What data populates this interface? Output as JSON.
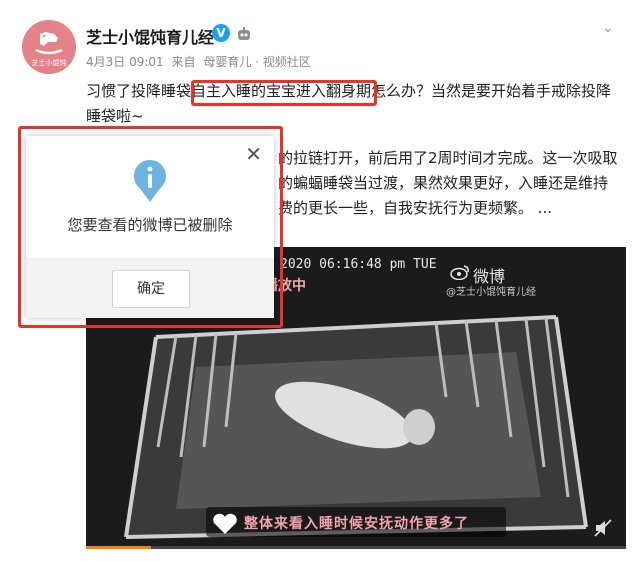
{
  "post": {
    "username": "芝士小馄饨育儿经",
    "verified_badge": "V",
    "avatar_caption": "芝士小馄饨",
    "meta": {
      "date": "4月3日 09:01",
      "from_label": "来自",
      "source": "母婴育儿 · 视频社区"
    },
    "text_lines": [
      "习惯了投降睡袋自主入睡的宝宝进入翻身期怎么办？当然是要开始着手戒除投降",
      "睡袋啦~",
      "的拉链打开，前后用了2周时间才完成。这一次吸取",
      "的蝙蝠睡袋当过渡，果然效果更好，入睡还是维持",
      "费的更长一些，自我安抚行为更频繁。 ..."
    ],
    "highlight_text": "自主入睡的宝宝进入翻身期"
  },
  "video": {
    "timestamp": "2020 06:16:48 pm TUE",
    "replay_label": "播放中",
    "watermark_brand": "微博",
    "watermark_user": "@芝士小馄饨育儿经",
    "caption": "整体来看入睡时候安抚动作更多了",
    "progress": 0.12
  },
  "dialog": {
    "message": "您要查看的微博已被删除",
    "ok_label": "确定",
    "close_symbol": "✕"
  },
  "icons": {
    "chevron": "chevron-down-icon",
    "info": "info-icon",
    "mute": "mute-icon"
  },
  "colors": {
    "accent_red": "#e8322b",
    "weibo_blue": "#1ea1f2",
    "info_blue": "#6fb3e0"
  }
}
